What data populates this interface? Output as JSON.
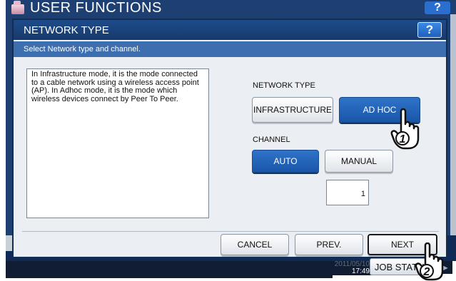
{
  "background": {
    "title": "USER FUNCTIONS",
    "help_label": "?",
    "clock": "17:49",
    "clock_date": "2011/05/10",
    "jobs_label": "JOB STATUS"
  },
  "dialog": {
    "title": "NETWORK TYPE",
    "help_label": "?",
    "instruction": "Select Network type and channel.",
    "description": "In Infrastructure mode, it is the mode connected to a cable network using a wireless access point (AP). In Adhoc mode, it is the mode which wireless devices connect by Peer To Peer.",
    "network_type": {
      "label": "NETWORK TYPE",
      "options": [
        "INFRASTRUCTURE",
        "AD HOC"
      ],
      "selected": "AD HOC"
    },
    "channel": {
      "label": "CHANNEL",
      "options": [
        "AUTO",
        "MANUAL"
      ],
      "selected": "AUTO",
      "value": "1"
    },
    "footer": {
      "cancel_label": "CANCEL",
      "prev_label": "PREV.",
      "next_label": "NEXT"
    }
  },
  "callouts": [
    "1",
    "2"
  ],
  "colors": {
    "header_blue": "#1d4b8a",
    "instruction_blue": "#3d6fb0",
    "selected_button": "#1a56a8",
    "dialog_bg": "#ebeef2"
  }
}
